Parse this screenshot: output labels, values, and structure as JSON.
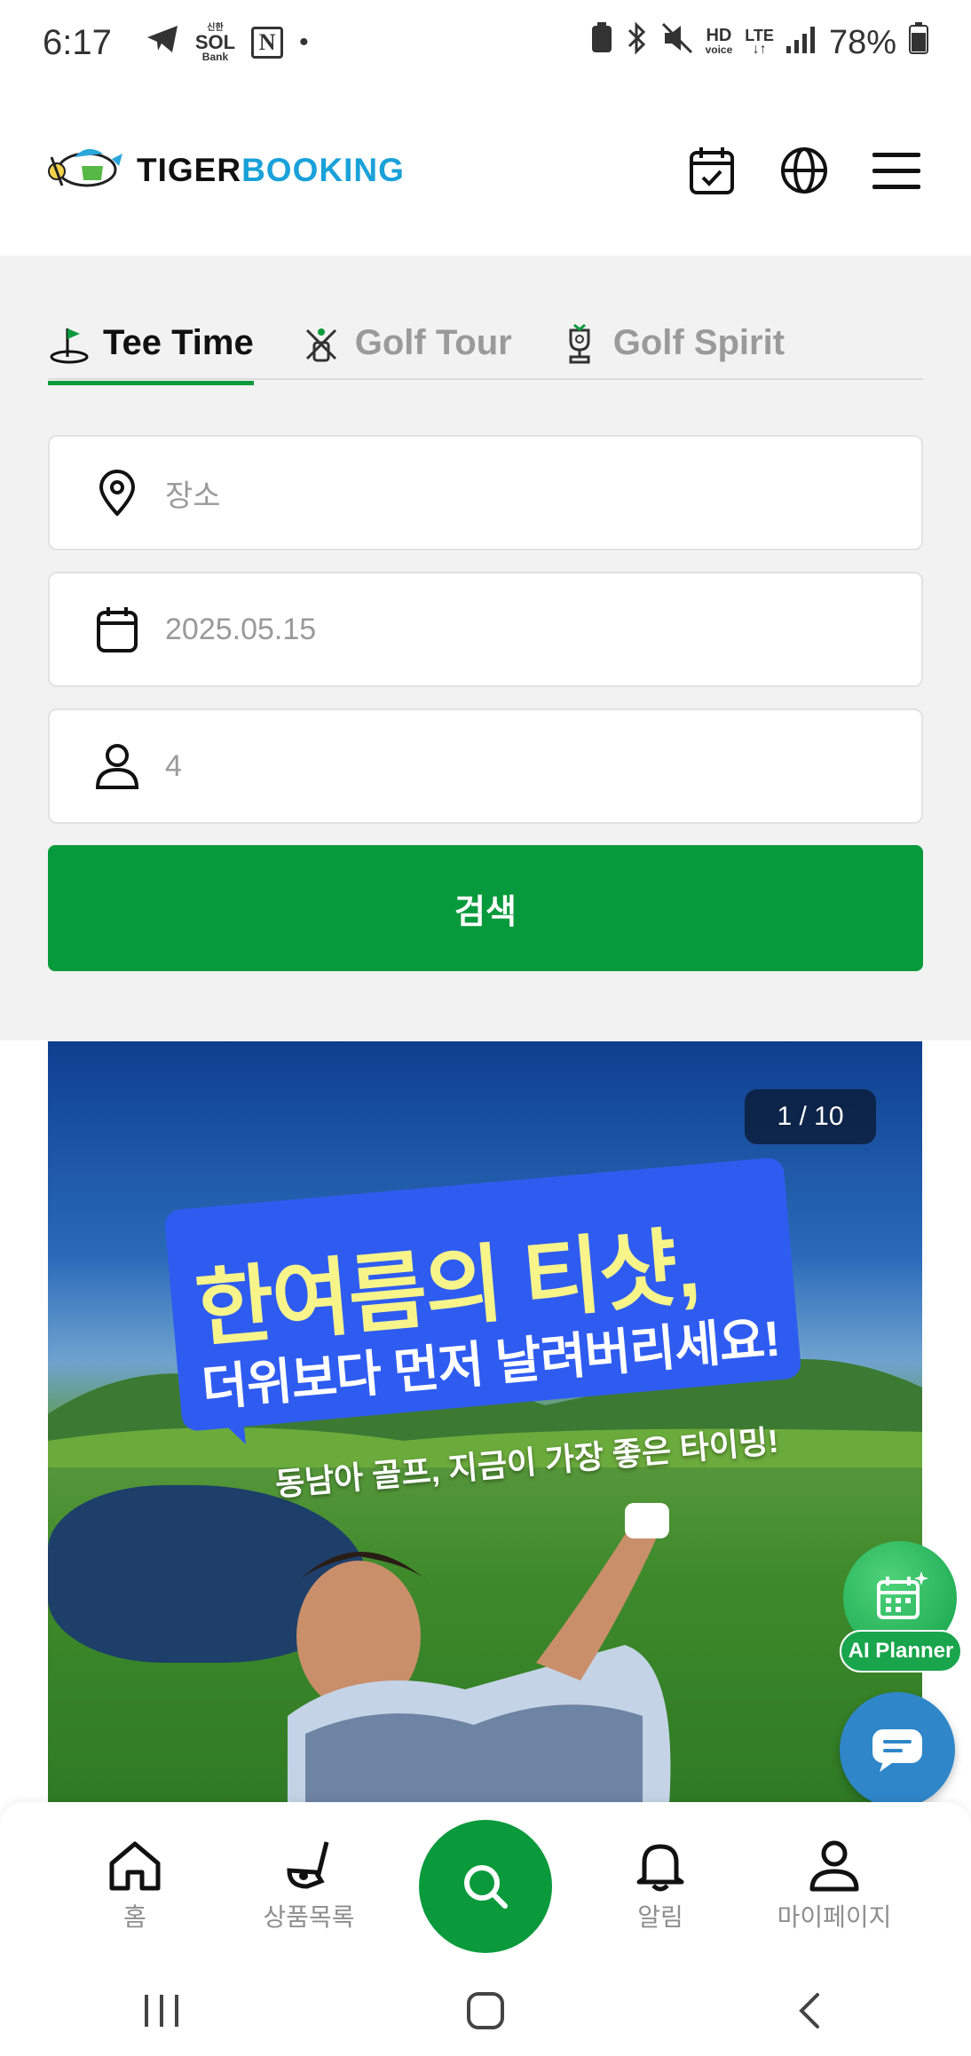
{
  "status_bar": {
    "time": "6:17",
    "bank_label_top": "신한",
    "bank_label_bottom": "Bank",
    "notion_letter": "N",
    "dot": "•",
    "hd_voice_top": "HD",
    "hd_voice_bottom": "voice",
    "lte": "LTE",
    "battery": "78%"
  },
  "header": {
    "logo_text_1": "TIGER",
    "logo_text_2": "BOOKING"
  },
  "tabs": [
    {
      "label": "Tee Time",
      "active": true
    },
    {
      "label": "Golf Tour",
      "active": false
    },
    {
      "label": "Golf Spirit",
      "active": false
    }
  ],
  "search": {
    "location_placeholder": "장소",
    "date_value": "2025.05.15",
    "people_value": "4",
    "button_label": "검색"
  },
  "banner": {
    "counter": "1 / 10",
    "headline_1": "한여름의 티샷,",
    "headline_2": "더위보다 먼저 날려버리세요!",
    "headline_3": "동남아 골프, 지금이 가장 좋은 타이밍!"
  },
  "floating": {
    "ai_planner_label": "AI Planner"
  },
  "bottom_nav": {
    "home": "홈",
    "products": "상품목록",
    "alerts": "알림",
    "mypage": "마이페이지"
  },
  "colors": {
    "brand_green": "#0a9a3c",
    "brand_blue": "#1aa1d9",
    "banner_blue": "#2f5cf0",
    "headline_yellow": "#f7f48a"
  }
}
